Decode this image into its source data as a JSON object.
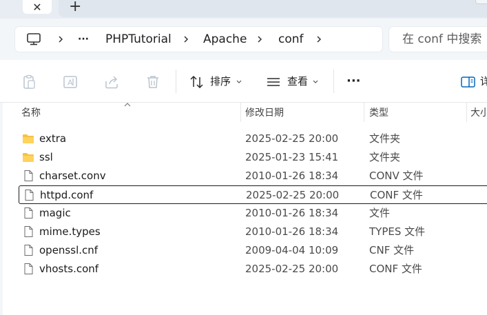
{
  "tabs": {
    "close_glyph": "✕",
    "new_glyph": "+"
  },
  "breadcrumb": {
    "more": "···",
    "items": [
      "PHPTutorial",
      "Apache",
      "conf"
    ]
  },
  "search": {
    "placeholder": "在 conf 中搜索"
  },
  "toolbar": {
    "sort_label": "排序",
    "view_label": "查看",
    "more_label": "···",
    "right_label": "详"
  },
  "columns": {
    "name": "名称",
    "date": "修改日期",
    "type": "类型",
    "size": "大小"
  },
  "files": [
    {
      "name": "extra",
      "date": "2025-02-25 20:00",
      "type": "文件夹",
      "kind": "folder"
    },
    {
      "name": "ssl",
      "date": "2025-01-23 15:41",
      "type": "文件夹",
      "kind": "folder"
    },
    {
      "name": "charset.conv",
      "date": "2010-01-26 18:34",
      "type": "CONV 文件",
      "kind": "file"
    },
    {
      "name": "httpd.conf",
      "date": "2025-02-25 20:00",
      "type": "CONF 文件",
      "kind": "file",
      "selected": true
    },
    {
      "name": "magic",
      "date": "2010-01-26 18:34",
      "type": "文件",
      "kind": "file"
    },
    {
      "name": "mime.types",
      "date": "2010-01-26 18:34",
      "type": "TYPES 文件",
      "kind": "file"
    },
    {
      "name": "openssl.cnf",
      "date": "2009-04-04 10:09",
      "type": "CNF 文件",
      "kind": "file"
    },
    {
      "name": "vhosts.conf",
      "date": "2025-02-25 20:00",
      "type": "CONF 文件",
      "kind": "file"
    }
  ],
  "colors": {
    "folder": "#f6c244",
    "accent": "#0067c0",
    "chrome": "#f3f6f9"
  }
}
